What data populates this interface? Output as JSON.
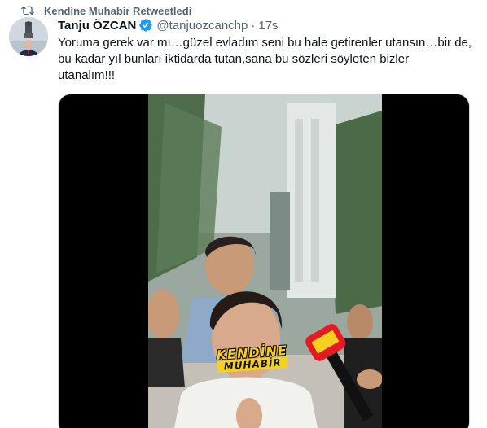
{
  "retweet": {
    "label": "Kendine Muhabir Retweetledi"
  },
  "tweet": {
    "display_name": "Tanju ÖZCAN",
    "handle": "@tanjuozcanchp",
    "separator": "·",
    "time": "17s",
    "text_lines": [
      "Yoruma gerek var mı…güzel evladım seni bu hale getirenler utansın…bir de,",
      "bu kadar yıl bunları iktidarda tutan,sana bu sözleri söyleten bizler",
      "utanalım!!!"
    ]
  },
  "media": {
    "watermark_top": "KENDİNE",
    "watermark_bottom": "MUHABİR"
  },
  "colors": {
    "accent": "#1d9bf0",
    "muted": "#536471",
    "text": "#0f1419",
    "watermark": "#f5d020",
    "mic": "#e31b23"
  },
  "icons": {
    "retweet": "retweet-icon",
    "verified": "verified-badge-icon"
  }
}
